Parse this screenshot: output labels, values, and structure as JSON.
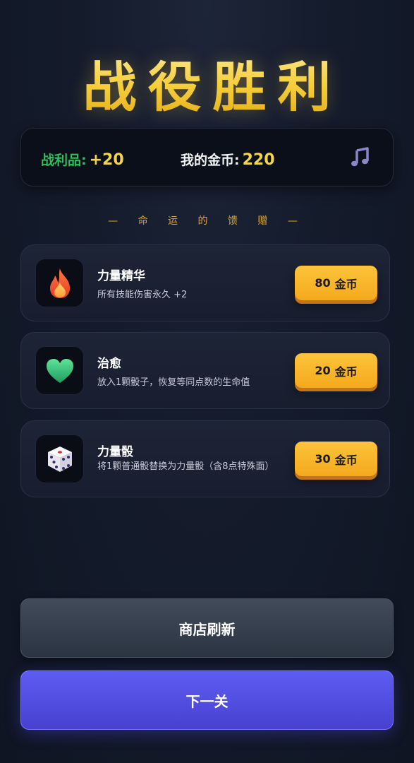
{
  "header": {
    "title": "战役胜利"
  },
  "stats": {
    "loot_label": "战利品:",
    "loot_value": "+20",
    "coins_label": "我的金币:",
    "coins_value": "220",
    "music_icon": "music-note-icon"
  },
  "section": {
    "title": "— 命 运 的 馈 赠 —"
  },
  "items": [
    {
      "name": "力量精华",
      "description": "所有技能伤害永久 +2",
      "price": "80",
      "currency": "金币",
      "icon": "fire-icon"
    },
    {
      "name": "治愈",
      "description": "放入1颗骰子，恢复等同点数的生命值",
      "price": "20",
      "currency": "金币",
      "icon": "green-heart-icon"
    },
    {
      "name": "力量骰",
      "description": "将1颗普通骰替换为力量骰（含8点特殊面）",
      "price": "30",
      "currency": "金币",
      "icon": "dice-icon"
    }
  ],
  "buttons": {
    "refresh_label": "商店刷新",
    "next_label": "下一关"
  },
  "colors": {
    "gold": "#f6d54a",
    "loot_green": "#2fbf5a",
    "buy_button": "#fcc43a",
    "next_button": "#5d5df2",
    "refresh_button": "#414b5a"
  }
}
